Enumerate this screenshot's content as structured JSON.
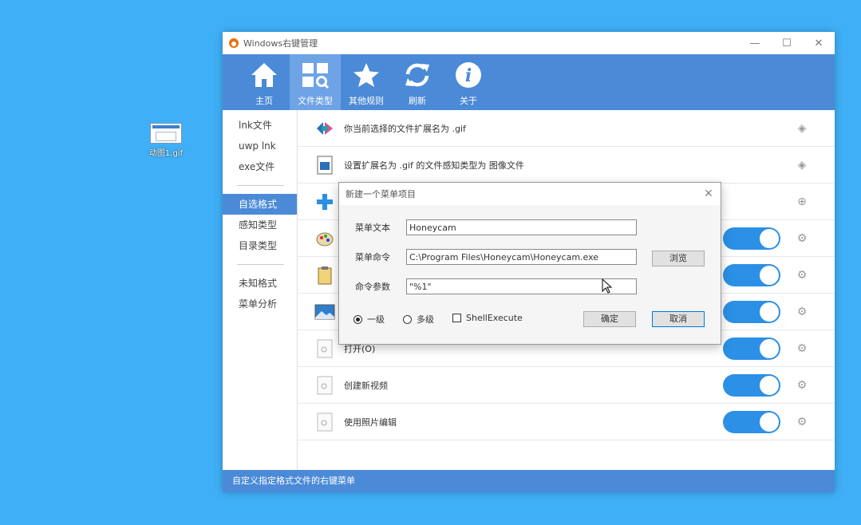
{
  "desktop": {
    "icon_label": "动图1.gif"
  },
  "window": {
    "title": "Windows右键管理",
    "controls": {
      "minimize": "—",
      "maximize": "☐",
      "close": "✕"
    }
  },
  "toolbar": {
    "items": [
      {
        "label": "主页",
        "icon": "home-icon"
      },
      {
        "label": "文件类型",
        "icon": "file-type-icon",
        "active": true
      },
      {
        "label": "其他规则",
        "icon": "star-icon"
      },
      {
        "label": "刷新",
        "icon": "refresh-icon"
      },
      {
        "label": "关于",
        "icon": "info-icon"
      }
    ]
  },
  "sidebar": {
    "items": [
      "lnk文件",
      "uwp lnk",
      "exe文件",
      "自选格式",
      "感知类型",
      "目录类型",
      "未知格式",
      "菜单分析"
    ],
    "selected": "自选格式"
  },
  "content": {
    "rows": [
      {
        "text": "你当前选择的文件扩展名为 .gif"
      },
      {
        "text": "设置扩展名为 .gif 的文件感知类型为 图像文件"
      },
      {
        "text": ""
      },
      {
        "text": ""
      },
      {
        "text": ""
      },
      {
        "text": ""
      },
      {
        "text": "打开(O)"
      },
      {
        "text": "创建新视频"
      },
      {
        "text": "使用照片编辑"
      }
    ]
  },
  "statusbar": {
    "text": "自定义指定格式文件的右键菜单"
  },
  "dialog": {
    "title": "新建一个菜单项目",
    "close": "✕",
    "menu_text_label": "菜单文本",
    "menu_text_value": "Honeycam",
    "menu_cmd_label": "菜单命令",
    "menu_cmd_value": "C:\\Program Files\\Honeycam\\Honeycam.exe",
    "browse": "浏览",
    "cmd_param_label": "命令参数",
    "cmd_param_value": "\"%1\"",
    "level1": "一级",
    "multi": "多级",
    "shellexecute": "ShellExecute",
    "ok": "确定",
    "cancel": "取消"
  },
  "colors": {
    "accent": "#4b8ad7",
    "toggle": "#2b90e6",
    "desktop": "#3fb0f7"
  }
}
